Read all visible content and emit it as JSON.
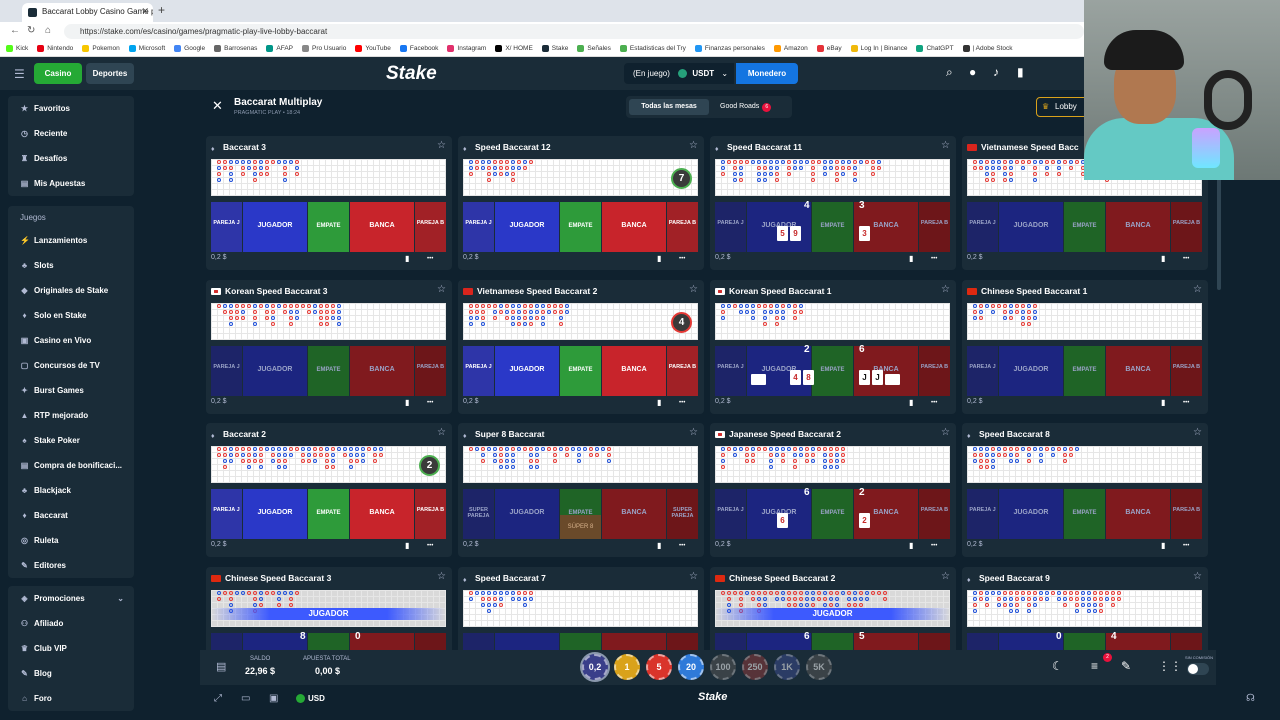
{
  "browser": {
    "tab_title": "Baccarat Lobby Casino Game por",
    "url": "https://stake.com/es/casino/games/pragmatic-play-live-lobby-baccarat",
    "bookmarks": [
      "Kick",
      "Nintendo",
      "Pokemon",
      "Microsoft",
      "Google",
      "Barrosenas",
      "AFAP",
      "Pro Usuario",
      "YouTube",
      "Facebook",
      "Instagram",
      "X/ HOME",
      "Stake",
      "Señales",
      "Estadisticas del Try",
      "Finanzas personales",
      "Amazon",
      "eBay",
      "Log In | Binance",
      "ChatGPT",
      "| Adobe Stock"
    ]
  },
  "topbar": {
    "casino": "Casino",
    "deportes": "Deportes",
    "logo": "Stake",
    "balance_label": "(En juego)",
    "currency": "USDT",
    "monedero": "Monedero"
  },
  "sidebar": {
    "top": [
      "Favoritos",
      "Reciente",
      "Desafíos",
      "Mis Apuestas"
    ],
    "section_title": "Juegos",
    "games": [
      "Lanzamientos",
      "Slots",
      "Originales de Stake",
      "Solo en Stake",
      "Casino en Vivo",
      "Concursos de TV",
      "Burst Games",
      "RTP mejorado",
      "Stake Poker",
      "Compra de bonificaci...",
      "Blackjack",
      "Baccarat",
      "Ruleta",
      "Editores"
    ],
    "bottom": [
      "Promociones",
      "Afiliado",
      "Club VIP",
      "Blog",
      "Foro"
    ]
  },
  "main": {
    "title": "Baccarat Multiplay",
    "subtitle": "PRAGMATIC PLAY • 18:24",
    "filter_all": "Todas las mesas",
    "filter_good": "Good Roads",
    "good_count": "6",
    "lobby": "Lobby"
  },
  "bet_labels": {
    "pareja_j": "PAREJA J",
    "jugador": "JUGADOR",
    "empate": "EMPATE",
    "banca": "BANCA",
    "pareja_b": "PAREJA B",
    "super_pareja": "SUPER PAREJA",
    "super8": "SÚPER 8"
  },
  "tables": [
    {
      "name": "Baccarat 3",
      "flag": "",
      "count": "",
      "min": "0,2 $"
    },
    {
      "name": "Speed Baccarat 12",
      "flag": "",
      "count": "7",
      "min": "0,2 $"
    },
    {
      "name": "Speed Baccarat 11",
      "flag": "",
      "count": "",
      "min": "0,2 $",
      "p_total": "4",
      "b_total": "3",
      "p_cards": [
        "5",
        "9"
      ],
      "b_cards": [
        "3"
      ]
    },
    {
      "name": "Vietnamese Speed Bacc",
      "flag": "vn",
      "count": "",
      "min": "0,2 $"
    },
    {
      "name": "Korean Speed Baccarat 3",
      "flag": "kr",
      "count": "",
      "min": "0,2 $"
    },
    {
      "name": "Vietnamese Speed Baccarat 2",
      "flag": "vn",
      "count": "4",
      "min": "0,2 $"
    },
    {
      "name": "Korean Speed Baccarat 1",
      "flag": "kr",
      "count": "",
      "min": "0,2 $",
      "p_total": "2",
      "b_total": "6",
      "p_cards": [
        "",
        "4",
        "8"
      ],
      "b_cards": [
        "J",
        "J",
        ""
      ]
    },
    {
      "name": "Chinese Speed Baccarat 1",
      "flag": "cn",
      "count": "",
      "min": "0,2 $"
    },
    {
      "name": "Baccarat 2",
      "flag": "",
      "count": "2",
      "min": "0,2 $"
    },
    {
      "name": "Super 8 Baccarat",
      "flag": "",
      "count": "",
      "min": "0,2 $"
    },
    {
      "name": "Japanese Speed Baccarat 2",
      "flag": "jp",
      "count": "",
      "min": "0,2 $",
      "p_total": "6",
      "b_total": "2",
      "p_cards": [
        "6"
      ],
      "b_cards": [
        "2"
      ]
    },
    {
      "name": "Speed Baccarat 8",
      "flag": "",
      "count": "",
      "min": "0,2 $"
    },
    {
      "name": "Chinese Speed Baccarat 3",
      "flag": "cn",
      "count": "",
      "min": "",
      "winner": "JUGADOR",
      "p_total": "8",
      "b_total": "0"
    },
    {
      "name": "Speed Baccarat 7",
      "flag": "",
      "count": "",
      "min": ""
    },
    {
      "name": "Chinese Speed Baccarat 2",
      "flag": "cn",
      "count": "",
      "min": "",
      "winner": "JUGADOR",
      "p_total": "6",
      "b_total": "5"
    },
    {
      "name": "Speed Baccarat 9",
      "flag": "",
      "count": "",
      "min": "",
      "p_total": "0",
      "b_total": "4"
    }
  ],
  "bottombar": {
    "saldo_label": "SALDO",
    "saldo": "22,96 $",
    "apuesta_label": "APUESTA TOTAL",
    "apuesta": "0,00 $",
    "chips": [
      "0,2",
      "1",
      "5",
      "20",
      "100",
      "250",
      "1K",
      "5K"
    ],
    "notif": "2",
    "sin_comision": "SIN COMISIÓN"
  },
  "footer": {
    "currency": "USD",
    "logo": "Stake"
  }
}
